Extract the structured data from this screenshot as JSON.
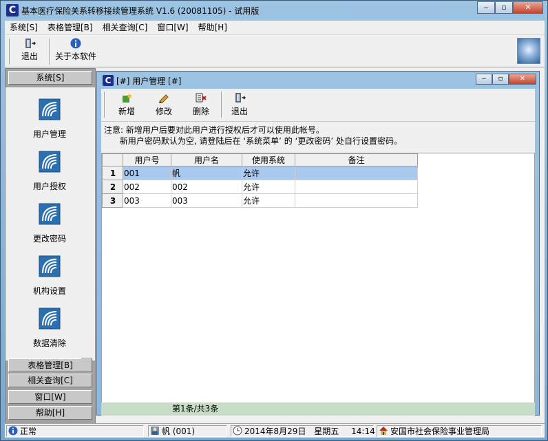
{
  "window": {
    "app_icon_letter": "C",
    "title": "基本医疗保险关系转移接续管理系统  V1.6 (20081105) - 试用版",
    "min_label": "‒",
    "max_label": "▫",
    "close_label": "✕"
  },
  "menubar": {
    "items": [
      "系统[S]",
      "表格管理[B]",
      "相关查询[C]",
      "窗口[W]",
      "帮助[H]"
    ]
  },
  "toolbar": {
    "exit_label": "退出",
    "about_label": "关于本软件"
  },
  "sidebar": {
    "header_system": "系统[S]",
    "items": [
      "用户管理",
      "用户授权",
      "更改密码",
      "机构设置",
      "数据清除"
    ],
    "scroll_glyph": "▼",
    "header_tables": "表格管理[B]",
    "header_query": "相关查询[C]",
    "header_window": "窗口[W]",
    "header_help": "帮助[H]"
  },
  "child": {
    "icon_letter": "C",
    "title": "[#] 用户管理 [#]",
    "toolbar": {
      "add_label": "新增",
      "edit_label": "修改",
      "delete_label": "删除",
      "exit_label": "退出"
    },
    "notice_line1": "注意: 新增用户后要对此用户进行授权后才可以使用此帐号。",
    "notice_line2": "      新用户密码默认为空, 请登陆后在 ‘系统菜单’ 的 ‘更改密码’ 处自行设置密码。",
    "grid": {
      "columns": [
        "用户号",
        "用户名",
        "使用系统",
        "备注"
      ],
      "rows": [
        {
          "no": "1",
          "cells": [
            "001",
            "帆",
            "允许",
            ""
          ]
        },
        {
          "no": "2",
          "cells": [
            "002",
            "002",
            "允许",
            ""
          ]
        },
        {
          "no": "3",
          "cells": [
            "003",
            "003",
            "允许",
            ""
          ]
        }
      ]
    },
    "record_status": "第1条/共3条"
  },
  "statusbar": {
    "status": "正常",
    "user": "帆 (001)",
    "date": "2014年8月29日",
    "weekday": "星期五",
    "time": "14:14",
    "org": "安国市社会保险事业管理局"
  },
  "colors": {
    "selected_row": "#a9c9ef",
    "status_strip": "#c7ddc7",
    "frame": "#9cc3e2"
  }
}
